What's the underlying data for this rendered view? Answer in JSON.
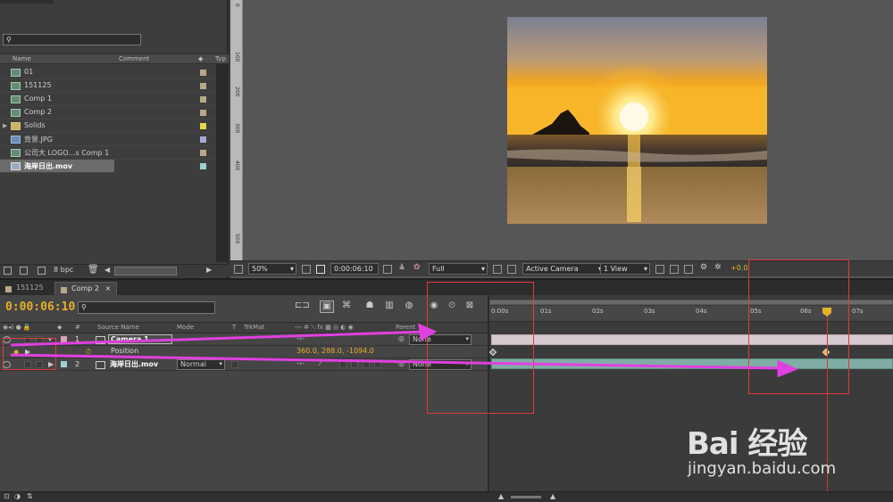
{
  "project": {
    "columns": [
      "Name",
      "Comment",
      "Typ"
    ],
    "items": [
      {
        "name": "01",
        "kind": "comp",
        "label_color": "#b8a88a"
      },
      {
        "name": "151125",
        "kind": "comp",
        "label_color": "#b8a88a"
      },
      {
        "name": "Comp 1",
        "kind": "comp",
        "label_color": "#b8a88a"
      },
      {
        "name": "Comp 2",
        "kind": "comp",
        "label_color": "#b8a88a"
      },
      {
        "name": "Solids",
        "kind": "folder",
        "label_color": "#e8d84a"
      },
      {
        "name": "背景.JPG",
        "kind": "image",
        "label_color": "#a8a8d8"
      },
      {
        "name": "公司大 LOGO…s Comp 1",
        "kind": "comp",
        "label_color": "#b8a88a"
      },
      {
        "name": "海岸日出.mov",
        "kind": "movie",
        "label_color": "#9fd0d0",
        "selected": true
      }
    ],
    "bpc": "8 bpc"
  },
  "viewer": {
    "ruler_ticks": [
      "0",
      "100",
      "200",
      "300",
      "400",
      "500"
    ],
    "zoom": "50%",
    "timecode": "0:00:06:10",
    "resolution": "Full",
    "camera": "Active Camera",
    "views": "1 View",
    "exposure": "+0.0"
  },
  "tabs": [
    {
      "label": "151125",
      "color": "#b8a88a",
      "active": false
    },
    {
      "label": "Comp 2",
      "color": "#b8a88a",
      "active": true
    }
  ],
  "timeline": {
    "current_time": "0:00:06:10",
    "columns": {
      "source_name": "Source Name",
      "mode": "Mode",
      "t": "T",
      "trkmat": "TrkMat",
      "parent": "Parent"
    },
    "layers": [
      {
        "num": "1",
        "name": "Camera 1",
        "label_color": "#d8a0b8",
        "parent": "None",
        "kind": "camera"
      },
      {
        "num": "2",
        "name": "海岸日出.mov",
        "label_color": "#9fd0d0",
        "mode": "Normal",
        "parent": "None",
        "kind": "movie"
      }
    ],
    "property": {
      "name": "Position",
      "value": "360.0, 288.0, -1094.0"
    },
    "ticks": [
      "0:00s",
      "01s",
      "02s",
      "03s",
      "04s",
      "05s",
      "06s",
      "07s"
    ]
  },
  "watermark": {
    "brand": "Bai 经验",
    "url": "jingyan.baidu.com"
  },
  "colors": {
    "accent_time": "#e5b02a",
    "annotation_red": "#e03b3b",
    "annotation_arrow": "#e040e0"
  }
}
